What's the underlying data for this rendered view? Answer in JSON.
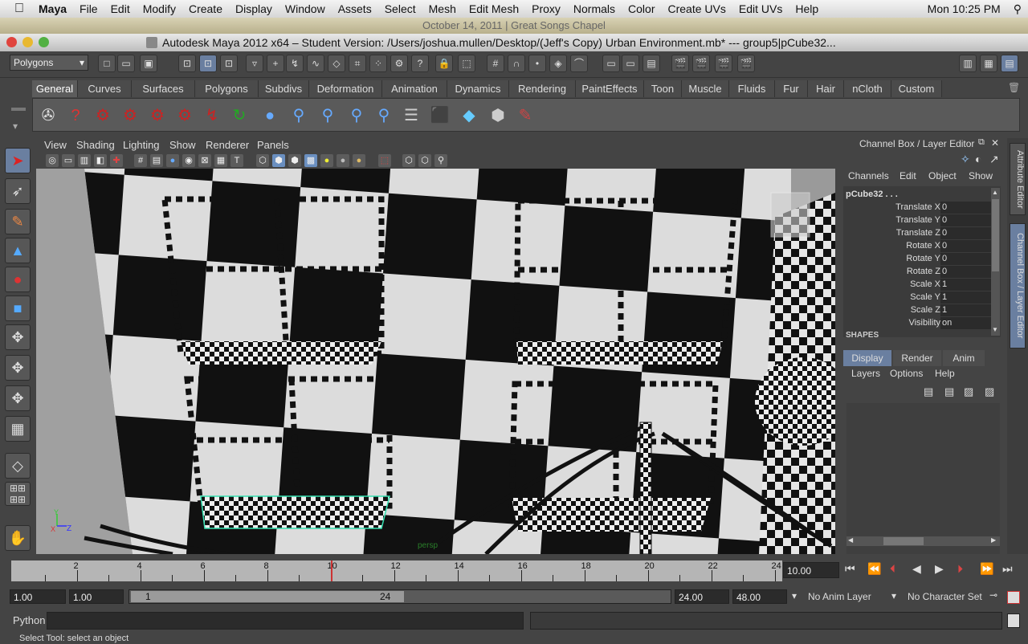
{
  "menubar": {
    "app_name": "Maya",
    "items": [
      "File",
      "Edit",
      "Modify",
      "Create",
      "Display",
      "Window",
      "Assets",
      "Select",
      "Mesh",
      "Edit Mesh",
      "Proxy",
      "Normals",
      "Color",
      "Create UVs",
      "Edit UVs",
      "Help"
    ],
    "clock": "Mon 10:25 PM"
  },
  "top_strip": "October 14, 2011 | Great Songs Chapel",
  "window": {
    "title": "Autodesk Maya 2012 x64 – Student Version: /Users/joshua.mullen/Desktop/(Jeff's Copy) Urban Environment.mb*   ---   group5|pCube32..."
  },
  "status_line": {
    "menu_set": "Polygons"
  },
  "shelf": {
    "tabs": [
      "General",
      "Curves",
      "Surfaces",
      "Polygons",
      "Subdivs",
      "Deformation",
      "Animation",
      "Dynamics",
      "Rendering",
      "PaintEffects",
      "Toon",
      "Muscle",
      "Fluids",
      "Fur",
      "Hair",
      "nCloth",
      "Custom"
    ],
    "active_tab": "General"
  },
  "viewport": {
    "menus": [
      "View",
      "Shading",
      "Lighting",
      "Show",
      "Renderer",
      "Panels"
    ],
    "camera_label": "persp",
    "axis_x": "X",
    "axis_y": "Y",
    "axis_z": "Z"
  },
  "channel_box": {
    "title": "Channel Box / Layer Editor",
    "menus": [
      "Channels",
      "Edit",
      "Object",
      "Show"
    ],
    "object_name": "pCube32 . . .",
    "attributes": [
      {
        "label": "Translate X",
        "value": "0"
      },
      {
        "label": "Translate Y",
        "value": "0"
      },
      {
        "label": "Translate Z",
        "value": "0"
      },
      {
        "label": "Rotate X",
        "value": "0"
      },
      {
        "label": "Rotate Y",
        "value": "0"
      },
      {
        "label": "Rotate Z",
        "value": "0"
      },
      {
        "label": "Scale X",
        "value": "1"
      },
      {
        "label": "Scale Y",
        "value": "1"
      },
      {
        "label": "Scale Z",
        "value": "1"
      },
      {
        "label": "Visibility",
        "value": "on"
      }
    ],
    "shapes_label": "SHAPES",
    "layer_tabs": [
      "Display",
      "Render",
      "Anim"
    ],
    "layer_menus": [
      "Layers",
      "Options",
      "Help"
    ]
  },
  "side_tabs": [
    "Attribute Editor",
    "Channel Box / Layer Editor"
  ],
  "time_slider": {
    "labels": [
      "2",
      "4",
      "6",
      "8",
      "10",
      "12",
      "14",
      "16",
      "18",
      "20",
      "22",
      "24"
    ],
    "current_frame": "10.00"
  },
  "range_slider": {
    "start_time": "1.00",
    "playback_start": "1.00",
    "range_start_label": "1",
    "range_end_label": "24",
    "playback_end": "24.00",
    "end_time": "48.00",
    "anim_layer": "No Anim Layer",
    "character_set": "No Character Set"
  },
  "command_line": {
    "language": "Python"
  },
  "help_line": "Select Tool: select an object"
}
